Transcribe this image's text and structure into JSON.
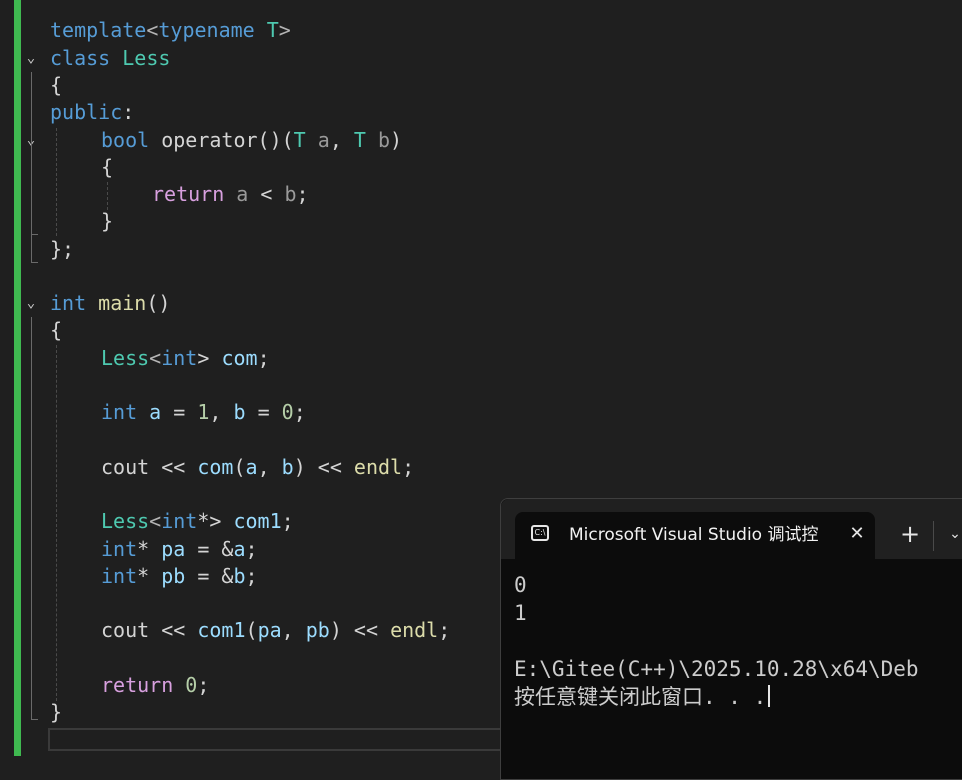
{
  "editor": {
    "lines": {
      "l1": {
        "a": "template",
        "b": "<",
        "c": "typename",
        "d": " ",
        "e": "T",
        ">": ">"
      },
      "l2": {
        "a": "class",
        "b": " ",
        "c": "Less"
      },
      "l3": {
        "a": "{"
      },
      "l4": {
        "a": "public",
        "b": ":"
      },
      "l5": {
        "a": "bool",
        "b": " ",
        "c": "operator",
        "d": "()(",
        "e": "T",
        "f": " ",
        "g": "a",
        "h": ", ",
        "i": "T",
        "j": " ",
        "k": "b",
        "l": ")"
      },
      "l6": {
        "a": "{"
      },
      "l7": {
        "a": "return",
        "b": " ",
        "c": "a",
        "d": " < ",
        "e": "b",
        "f": ";"
      },
      "l8": {
        "a": "}"
      },
      "l9": {
        "a": "};"
      },
      "l10": {
        "a": "int",
        "b": " ",
        "c": "main",
        "d": "()"
      },
      "l11": {
        "a": "{"
      },
      "l12": {
        "a": "Less",
        "b": "<",
        "c": "int",
        "d": "> ",
        "e": "com",
        "f": ";"
      },
      "l13": {
        "a": "int",
        "b": " ",
        "c": "a",
        "d": " = ",
        "e": "1",
        "f": ", ",
        "g": "b",
        "h": " = ",
        "i": "0",
        "j": ";"
      },
      "l14": {
        "a": "cout",
        "b": " << ",
        "c": "com",
        "d": "(",
        "e": "a",
        "f": ", ",
        "g": "b",
        "h": ") << ",
        "i": "endl",
        "j": ";"
      },
      "l15": {
        "a": "Less",
        "b": "<",
        "c": "int",
        "d": "*> ",
        "e": "com1",
        "f": ";"
      },
      "l16": {
        "a": "int",
        "b": "* ",
        "c": "pa",
        "d": " = &",
        "e": "a",
        "f": ";"
      },
      "l17": {
        "a": "int",
        "b": "* ",
        "c": "pb",
        "d": " = &",
        "e": "b",
        "f": ";"
      },
      "l18": {
        "a": "cout",
        "b": " << ",
        "c": "com1",
        "d": "(",
        "e": "pa",
        "f": ", ",
        "g": "pb",
        "h": ") << ",
        "i": "endl",
        "j": ";"
      },
      "l19": {
        "a": "return",
        "b": " ",
        "c": "0",
        "d": ";"
      },
      "l20": {
        "a": "}"
      }
    },
    "fold_glyph": "⌄"
  },
  "terminal": {
    "tab_title": "Microsoft Visual Studio 调试控",
    "tab_icon_text": "C:\\",
    "close_glyph": "✕",
    "new_tab_glyph": "+",
    "dropdown_glyph": "⌄",
    "output": [
      "0",
      "1",
      "E:\\Gitee(C++)\\2025.10.28\\x64\\Deb",
      "按任意键关闭此窗口. . ."
    ]
  }
}
